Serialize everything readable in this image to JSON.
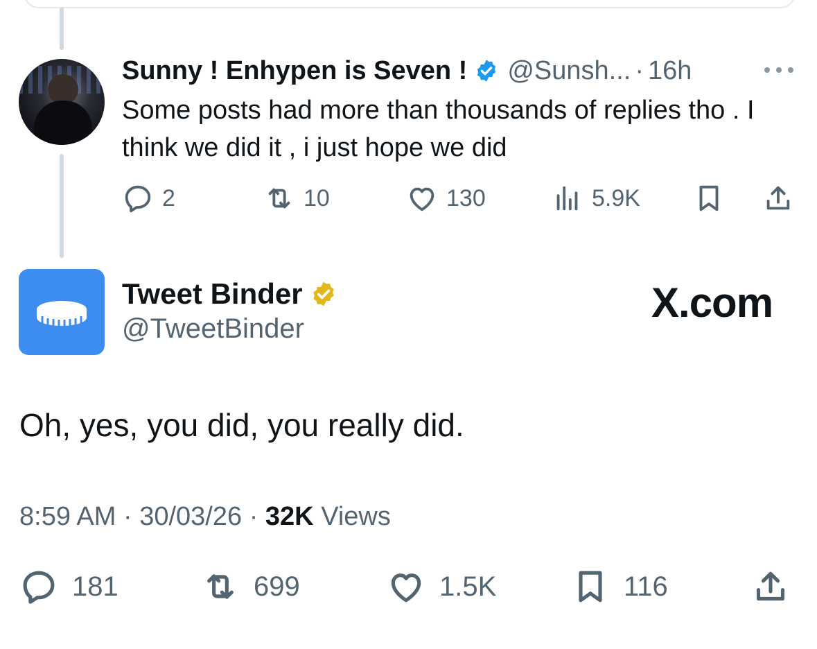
{
  "reply": {
    "display_name": "Sunny ! Enhypen is Seven !",
    "handle": "@Sunsh...",
    "separator": "·",
    "time": "16h",
    "text": "Some posts had more than thousands of replies tho . I think we did it , i just hope we did",
    "actions": {
      "replies": "2",
      "reposts": "10",
      "likes": "130",
      "views": "5.9K"
    }
  },
  "tweet": {
    "display_name": "Tweet Binder",
    "handle": "@TweetBinder",
    "brand_label": "X.com",
    "text": "Oh, yes, you did, you really did.",
    "time": "8:59 AM",
    "separator": "·",
    "date": "30/03/26",
    "views_count": "32K",
    "views_label": "Views",
    "actions": {
      "replies": "181",
      "reposts": "699",
      "likes": "1.5K",
      "bookmarks": "116"
    }
  },
  "colors": {
    "verified_blue": "#1d9bf0",
    "verified_gold": "#e2b719",
    "brand_avatar": "#3d8cf0",
    "muted_text": "#536471"
  }
}
